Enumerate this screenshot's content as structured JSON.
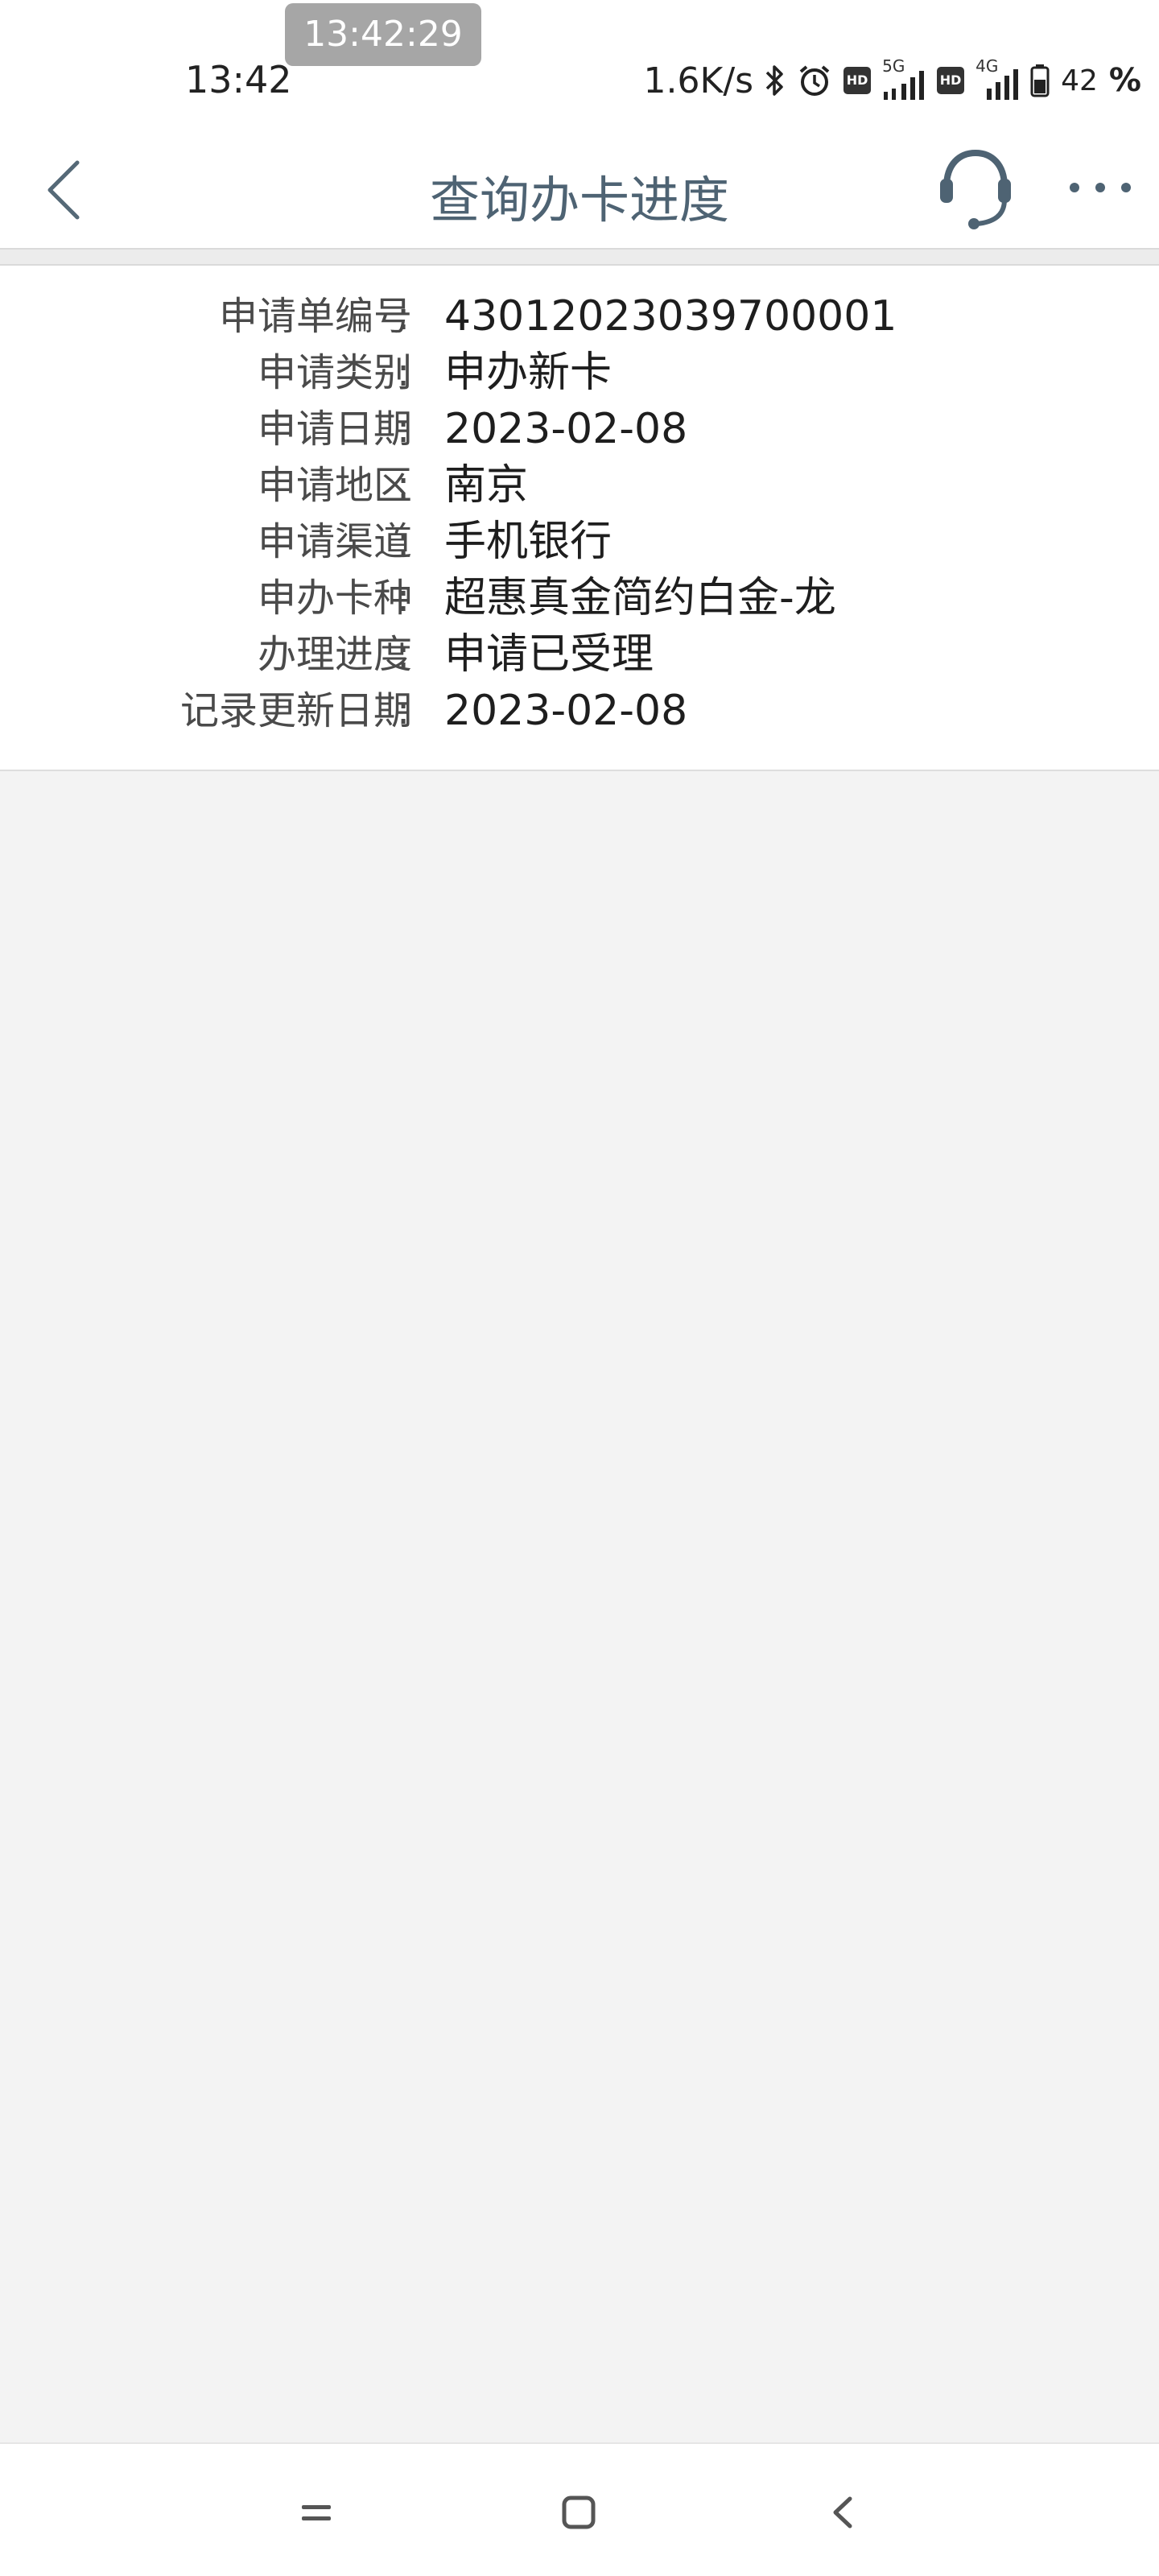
{
  "status_bar": {
    "time": "13:42",
    "screenshot_time": "13:42:29",
    "net_speed": "1.6K/s",
    "net1_label": "5G",
    "net2_label": "4G",
    "hd_label": "HD",
    "battery_percent": "42",
    "percent_sign": "%"
  },
  "header": {
    "title": "查询办卡进度",
    "back_icon": "chevron-left-icon",
    "service_icon": "headset-icon",
    "more_icon": "more-dots-icon"
  },
  "details": {
    "colon": ":",
    "rows": [
      {
        "label": "申请单编号",
        "value": "43012023039700001"
      },
      {
        "label": "申请类别",
        "value": "申办新卡"
      },
      {
        "label": "申请日期",
        "value": "2023-02-08"
      },
      {
        "label": "申请地区",
        "value": "南京"
      },
      {
        "label": "申请渠道",
        "value": "手机银行"
      },
      {
        "label": "申办卡种",
        "value": "超惠真金简约白金-龙"
      },
      {
        "label": "办理进度",
        "value": "申请已受理"
      },
      {
        "label": "记录更新日期",
        "value": "2023-02-08"
      }
    ]
  },
  "colors": {
    "title": "#4e6373",
    "background": "#f3f3f3",
    "card": "#ffffff"
  }
}
